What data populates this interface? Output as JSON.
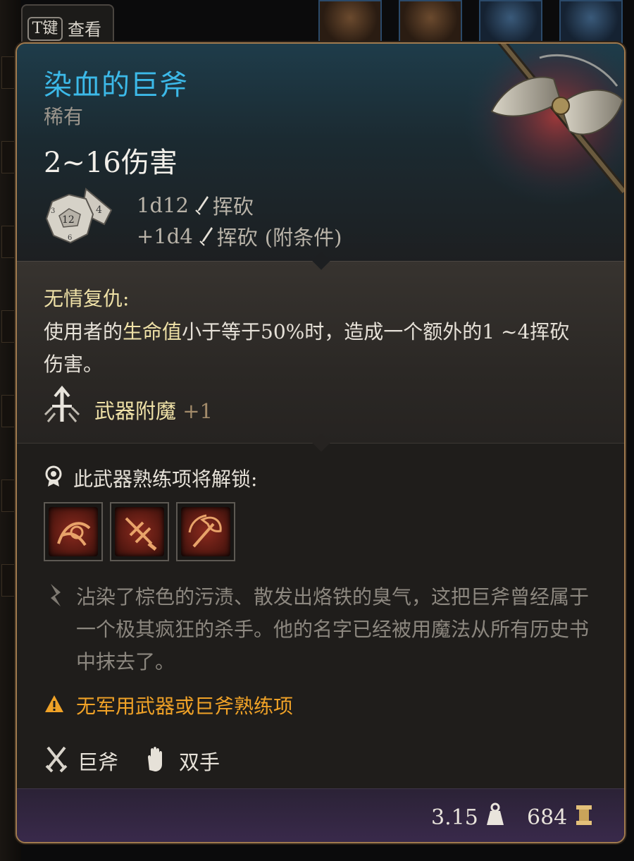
{
  "key_hint": {
    "key": "T键",
    "label": "查看"
  },
  "item": {
    "name": "染血的巨斧",
    "rarity": "稀有",
    "damage": "2~16伤害",
    "damage_rows": [
      {
        "dice": "1d12",
        "type": "挥砍",
        "note": ""
      },
      {
        "dice": "+1d4",
        "type": "挥砍",
        "note": "(附条件)"
      }
    ]
  },
  "passive": {
    "title": "无情复仇:",
    "desc_before": "使用者的",
    "desc_highlight": "生命值",
    "desc_after": "小于等于50%时，造成一个额外的1 ~4挥砍伤害。"
  },
  "enchantment": {
    "label": "武器附魔",
    "bonus": "+1"
  },
  "proficiency": {
    "title": "此武器熟练项将解锁:",
    "actions": [
      "cleave-action-icon",
      "lacerate-action-icon",
      "topple-action-icon"
    ]
  },
  "lore": "沾染了棕色的污渍、散发出烙铁的臭气，这把巨斧曾经属于一个极其疯狂的杀手。他的名字已经被用魔法从所有历史书中抹去了。",
  "warning": "无军用武器或巨斧熟练项",
  "tags": [
    {
      "icon": "crossed-swords-icon",
      "label": "巨斧"
    },
    {
      "icon": "hand-icon",
      "label": "双手"
    }
  ],
  "footer": {
    "weight": "3.15",
    "price": "684"
  },
  "colors": {
    "name": "#3cb9e8",
    "highlight": "#efe1a7",
    "warning": "#f0a227",
    "border": "#a07a4e"
  }
}
